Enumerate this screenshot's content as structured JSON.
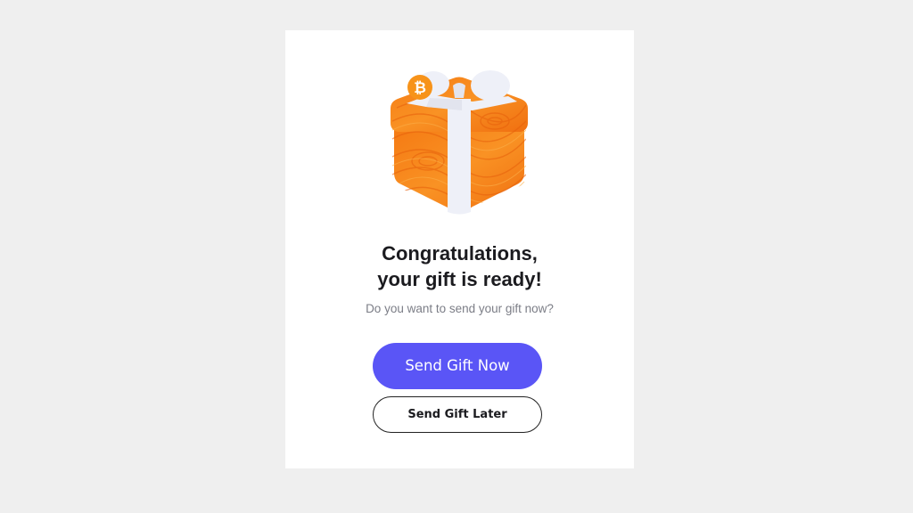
{
  "dialog": {
    "title_line1": "Congratulations,",
    "title_line2": "your gift is ready!",
    "subtitle": "Do you want to send your gift now?",
    "primary_button": "Send Gift Now",
    "secondary_button": "Send Gift Later"
  },
  "illustration": {
    "icon": "gift-box-icon",
    "badge_icon": "bitcoin-icon"
  },
  "colors": {
    "page_background": "#efefef",
    "card_background": "#ffffff",
    "primary_button": "#5a55f6",
    "gift_orange": "#f7861c",
    "ribbon": "#eef0f8"
  }
}
